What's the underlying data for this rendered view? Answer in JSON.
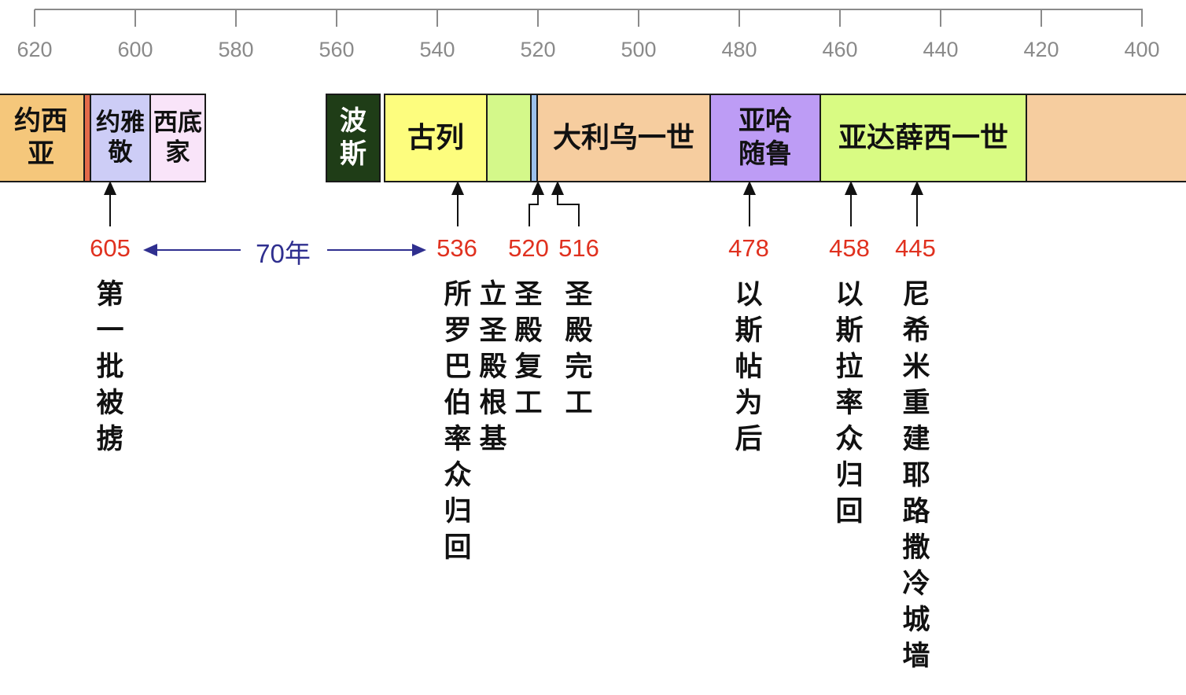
{
  "axis": {
    "ticks": [
      "620",
      "600",
      "580",
      "560",
      "540",
      "520",
      "500",
      "480",
      "460",
      "440",
      "420",
      "400"
    ],
    "color": "#8a8a8a"
  },
  "blocks": [
    {
      "id": "josiah",
      "lines": [
        "约西",
        "亚"
      ],
      "color": "#f5c77b"
    },
    {
      "id": "jehoiakim",
      "lines": [
        "约雅",
        "敬"
      ],
      "color": "#cdcdf6"
    },
    {
      "id": "zedekiah",
      "lines": [
        "西底",
        "家"
      ],
      "color": "#f9e4f9"
    },
    {
      "id": "persia",
      "lines": [
        "波",
        "斯"
      ],
      "color": "#1f3d17",
      "text_color": "#ffffff"
    },
    {
      "id": "cyrus",
      "lines": [
        "古列"
      ],
      "color": "#fdfd7e"
    },
    {
      "id": "green-gap",
      "lines": [],
      "color": "#d4f88a"
    },
    {
      "id": "blue-sliver",
      "lines": [],
      "color": "#9cc1ec"
    },
    {
      "id": "darius",
      "lines": [
        "大利乌一世"
      ],
      "color": "#f6cd9f"
    },
    {
      "id": "xerxes",
      "lines": [
        "亚哈",
        "随鲁"
      ],
      "color": "#bd9cf5"
    },
    {
      "id": "artaxerxes",
      "lines": [
        "亚达薛西一世"
      ],
      "color": "#d9fb83"
    },
    {
      "id": "after",
      "lines": [],
      "color": "#f6cd9f"
    }
  ],
  "markers": [
    {
      "year": "605",
      "text": "第一批被掳"
    },
    {
      "year": "536",
      "text": "所罗巴伯率众归回"
    },
    {
      "year": "520",
      "text": "立圣殿根基",
      "text2": "圣殿复工"
    },
    {
      "year": "516",
      "text": "圣殿完工"
    },
    {
      "year": "478",
      "text": "以斯帖为后"
    },
    {
      "year": "458",
      "text": "以斯拉率众归回"
    },
    {
      "year": "445",
      "text": "尼希米重建耶路撒冷城墙"
    }
  ],
  "interval": {
    "label": "70年",
    "color": "#2f2f8f"
  },
  "colors": {
    "year": "#e0311f",
    "axis": "#8a8a8a",
    "arrow": "#111111"
  }
}
